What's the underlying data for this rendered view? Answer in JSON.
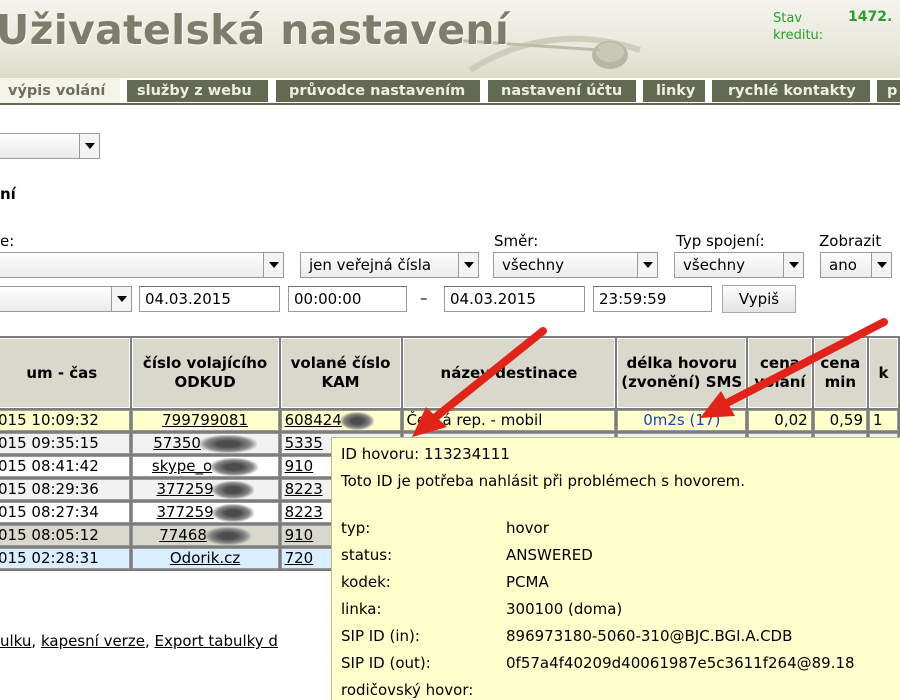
{
  "header": {
    "title": "Uživatelská nastavení",
    "credit_label": "Stav kreditu:",
    "credit_value": "1472."
  },
  "nav": {
    "tabs": [
      {
        "label": "výpis volání",
        "active": true
      },
      {
        "label": "služby z webu",
        "active": false
      },
      {
        "label": "průvodce nastavením",
        "active": false
      },
      {
        "label": "nastavení účtu",
        "active": false
      },
      {
        "label": "linky",
        "active": false
      },
      {
        "label": "rychlé kontakty",
        "active": false
      },
      {
        "label": "p",
        "active": false
      }
    ]
  },
  "section_title": "ní",
  "filters": {
    "top_select_value": "",
    "cut_label": "e:",
    "line_select_value": "",
    "number_filter": "jen veřejná čísla",
    "direction_label": "Směr:",
    "direction_value": "všechny",
    "type_label": "Typ spojení:",
    "type_value": "všechny",
    "show_label": "Zobrazit",
    "show_value": "ano",
    "period_select_value": "",
    "date_from": "04.03.2015",
    "time_from": "00:00:00",
    "dash": "–",
    "date_to": "04.03.2015",
    "time_to": "23:59:59",
    "submit": "Vypiš"
  },
  "table": {
    "headers": [
      "um - čas",
      "číslo volajícího ODKUD",
      "volané číslo KAM",
      "název destinace",
      "délka hovoru (zvonění) SMS",
      "cena volání",
      "cena min",
      "k"
    ],
    "rows": [
      {
        "datetime": "015 10:09:32",
        "from": "799799081",
        "to": "608424",
        "dest": "Česká rep. - mobil",
        "duration": "0m2s (17)",
        "price": "0,02",
        "price_min": "0,59",
        "k": "1"
      },
      {
        "datetime": "015 09:35:15",
        "from": "57350",
        "to": "5335",
        "dest": "",
        "duration": "",
        "price": "",
        "price_min": "",
        "k": ""
      },
      {
        "datetime": "015 08:41:42",
        "from": "skype_o",
        "to": "910",
        "dest": "",
        "duration": "",
        "price": "",
        "price_min": "",
        "k": ""
      },
      {
        "datetime": "015 08:29:36",
        "from": "377259",
        "to": "8223",
        "dest": "",
        "duration": "",
        "price": "",
        "price_min": "",
        "k": ""
      },
      {
        "datetime": "015 08:27:34",
        "from": "377259",
        "to": "8223",
        "dest": "",
        "duration": "",
        "price": "",
        "price_min": "",
        "k": ""
      },
      {
        "datetime": "015 08:05:12",
        "from": "77468",
        "to": "910",
        "dest": "",
        "duration": "",
        "price": "",
        "price_min": "",
        "k": ""
      },
      {
        "datetime": "015 02:28:31",
        "from": "Odorik.cz",
        "to": "720",
        "dest": "",
        "duration": "",
        "price": "",
        "price_min": "",
        "k": ""
      }
    ]
  },
  "footer": {
    "link1": "ulku",
    "link2": "kapesní verze",
    "link3": "Export tabulky d",
    "sep": ", "
  },
  "tooltip": {
    "id_line": "ID hovoru: 113234111",
    "note": "Toto ID je potřeba nahlásit při problémech s hovorem.",
    "fields": [
      {
        "key": "typ:",
        "value": "hovor"
      },
      {
        "key": "status:",
        "value": "ANSWERED"
      },
      {
        "key": "kodek:",
        "value": "PCMA"
      },
      {
        "key": "linka:",
        "value": "300100 (doma)"
      },
      {
        "key": "SIP ID (in):",
        "value": "896973180-5060-310@BJC.BGI.A.CDB"
      },
      {
        "key": "SIP ID (out):",
        "value": "0f57a4f40209d40061987e5c3611f264@89.18"
      },
      {
        "key": "rodičovský hovor:",
        "value": ""
      }
    ]
  },
  "colors": {
    "tab_bg": "#636a52",
    "tab_active_bg": "#f4f4ea",
    "credit": "#2aa02a",
    "arrow": "#e2231a",
    "tooltip_bg": "#ffffcc",
    "duration_link": "#1a44bb"
  }
}
